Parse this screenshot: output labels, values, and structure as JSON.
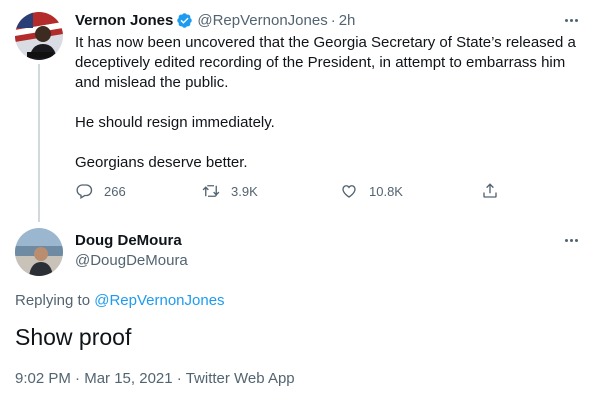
{
  "tweet1": {
    "name": "Vernon Jones",
    "handle": "@RepVernonJones",
    "separator": "·",
    "time": "2h",
    "paragraphs": [
      "It has now been uncovered that the Georgia Secretary of State’s released a deceptively edited recording of the President, in attempt to embarrass him and mislead the public.",
      "He should resign immediately.",
      "Georgians deserve better."
    ],
    "actions": {
      "replies": "266",
      "retweets": "3.9K",
      "likes": "10.8K"
    }
  },
  "tweet2": {
    "name": "Doug DeMoura",
    "handle": "@DougDeMoura",
    "replying_prefix": "Replying to",
    "replying_to": "@RepVernonJones",
    "text": "Show proof",
    "meta": {
      "time": "9:02 PM",
      "date": "Mar 15, 2021",
      "source": "Twitter Web App",
      "separator": "·"
    }
  },
  "colors": {
    "accent": "#1d9bf0",
    "secondary_text": "#536471",
    "primary_text": "#0f1419"
  },
  "icons": [
    "verified-badge-icon",
    "reply-icon",
    "retweet-icon",
    "like-icon",
    "share-icon",
    "more-icon"
  ]
}
